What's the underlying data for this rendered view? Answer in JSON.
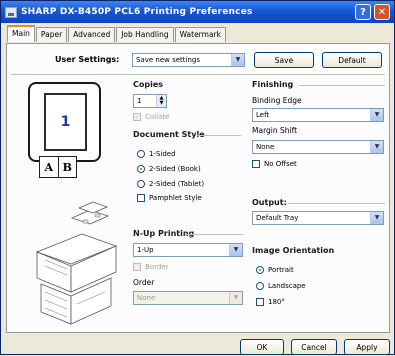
{
  "window": {
    "title": "SHARP DX-B450P PCL6 Printing Preferences",
    "help_glyph": "?",
    "close_glyph": "✕"
  },
  "tabs": [
    {
      "label": "Main",
      "active": true
    },
    {
      "label": "Paper",
      "active": false
    },
    {
      "label": "Advanced",
      "active": false
    },
    {
      "label": "Job Handling",
      "active": false
    },
    {
      "label": "Watermark",
      "active": false
    }
  ],
  "user_settings": {
    "label": "User Settings:",
    "value": "Save new settings",
    "save_label": "Save",
    "default_label": "Default"
  },
  "preview": {
    "page_number": "1",
    "side_a": "A",
    "side_b": "B"
  },
  "copies": {
    "title": "Copies",
    "value": "1",
    "collate_label": "Collate"
  },
  "document_style": {
    "title": "Document Style",
    "options": [
      "1-Sided",
      "2-Sided (Book)",
      "2-Sided (Tablet)"
    ],
    "selected": "2-Sided (Book)",
    "pamphlet_label": "Pamphlet Style"
  },
  "nup": {
    "title": "N-Up Printing",
    "value": "1-Up",
    "border_label": "Border",
    "order_label": "Order",
    "order_value": "None"
  },
  "finishing": {
    "title": "Finishing",
    "binding_edge_label": "Binding Edge",
    "binding_edge_value": "Left",
    "margin_shift_label": "Margin Shift",
    "margin_shift_value": "None",
    "no_offset_label": "No Offset"
  },
  "output": {
    "title": "Output:",
    "value": "Default Tray"
  },
  "orientation": {
    "title": "Image Orientation",
    "options": [
      "Portrait",
      "Landscape"
    ],
    "selected": "Portrait",
    "rotate_label": "180°"
  },
  "buttons": {
    "ok": "OK",
    "cancel": "Cancel",
    "apply": "Apply"
  }
}
